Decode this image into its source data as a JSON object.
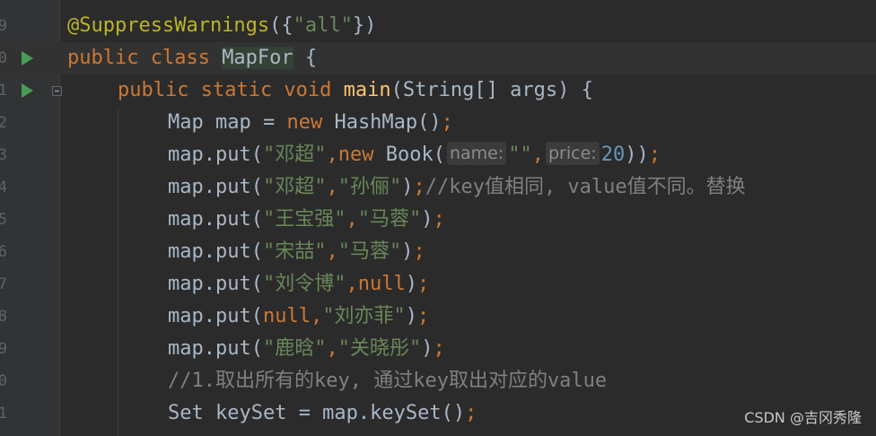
{
  "gutter": {
    "line_numbers": [
      "9",
      "0",
      "1",
      "2",
      "3",
      "4",
      "5",
      "6",
      "7",
      "8",
      "9",
      "0",
      "1"
    ]
  },
  "code": {
    "line1": {
      "ann": "@SuppressWarnings",
      "p1": "({",
      "str": "\"all\"",
      "p2": "})"
    },
    "line2": {
      "kw": "public class ",
      "cls": "MapFor",
      "rest": " {"
    },
    "line3": {
      "kw": "public static void ",
      "fn": "main",
      "rest": "(String[] args) {"
    },
    "line4": {
      "a": "Map map = ",
      "kw": "new",
      "b": " HashMap()",
      "semi": ";"
    },
    "line5": {
      "a": "map.put(",
      "s1": "\"邓超\"",
      "c1": ",",
      "kw": "new",
      "b": " Book(",
      "hint1": "name:",
      "s2": "\"\"",
      "c2": ",",
      "hint2": "price:",
      "num": "20",
      "e": "))",
      "semi": ";"
    },
    "line6": {
      "a": "map.put(",
      "s1": "\"邓超\"",
      "c1": ",",
      "s2": "\"孙俪\"",
      "e": ")",
      "semi": ";",
      "cmt": "//key值相同, value值不同。替换"
    },
    "line7": {
      "a": "map.put(",
      "s1": "\"王宝强\"",
      "c1": ",",
      "s2": "\"马蓉\"",
      "e": ")",
      "semi": ";"
    },
    "line8": {
      "a": "map.put(",
      "s1": "\"宋喆\"",
      "c1": ",",
      "s2": "\"马蓉\"",
      "e": ")",
      "semi": ";"
    },
    "line9": {
      "a": "map.put(",
      "s1": "\"刘令博\"",
      "c1": ",",
      "kw": "null",
      "e": ")",
      "semi": ";"
    },
    "line10": {
      "a": "map.put(",
      "kw": "null",
      "c1": ",",
      "s2": "\"刘亦菲\"",
      "e": ")",
      "semi": ";"
    },
    "line11": {
      "a": "map.put(",
      "s1": "\"鹿晗\"",
      "c1": ",",
      "s2": "\"关晓彤\"",
      "e": ")",
      "semi": ";"
    },
    "line12": {
      "cmt": "//1.取出所有的key, 通过key取出对应的value"
    },
    "line13": {
      "a": "Set keySet = map.keySet()",
      "semi": ";"
    }
  },
  "watermark": "CSDN @吉冈秀隆",
  "colors": {
    "background": "#2b2b2b",
    "keyword": "#cc7832",
    "string": "#6a8759",
    "annotation": "#bbb529",
    "number": "#6897bb",
    "method": "#ffc66d",
    "comment": "#808080",
    "run_icon": "#499c54"
  },
  "icons": [
    "run-icon",
    "fold-icon"
  ]
}
